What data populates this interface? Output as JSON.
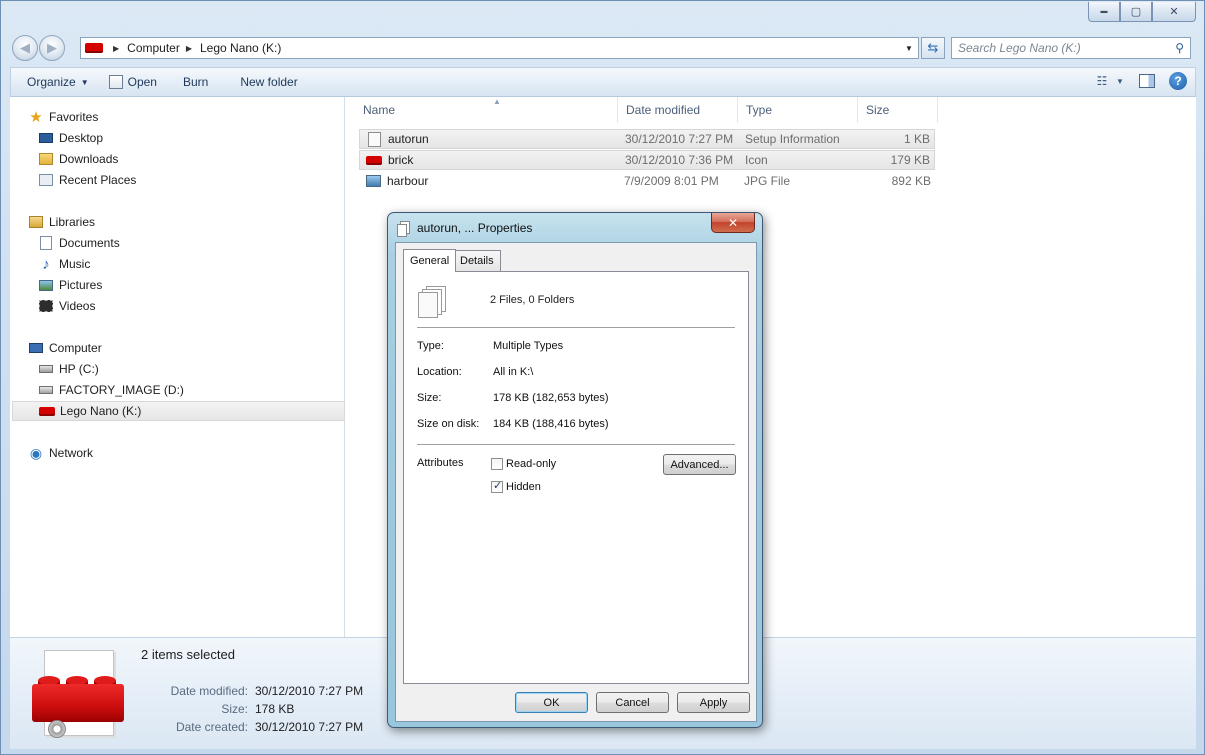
{
  "window": {
    "controls": {
      "minimize": "▬",
      "maximize": "▢",
      "close": "✕"
    }
  },
  "address": {
    "crumbs": [
      "Computer",
      "Lego Nano (K:)"
    ],
    "search_placeholder": "Search Lego Nano (K:)"
  },
  "toolbar": {
    "organize_label": "Organize",
    "open_label": "Open",
    "burn_label": "Burn",
    "new_folder_label": "New folder"
  },
  "sidebar": {
    "favorites": {
      "label": "Favorites",
      "items": [
        "Desktop",
        "Downloads",
        "Recent Places"
      ]
    },
    "libraries": {
      "label": "Libraries",
      "items": [
        "Documents",
        "Music",
        "Pictures",
        "Videos"
      ]
    },
    "computer": {
      "label": "Computer",
      "items": [
        "HP (C:)",
        "FACTORY_IMAGE (D:)",
        "Lego Nano (K:)"
      ]
    },
    "network": {
      "label": "Network"
    }
  },
  "file_list": {
    "columns": [
      "Name",
      "Date modified",
      "Type",
      "Size"
    ],
    "rows": [
      {
        "name": "autorun",
        "date": "30/12/2010 7:27 PM",
        "type": "Setup Information",
        "size": "1 KB",
        "selected": true
      },
      {
        "name": "brick",
        "date": "30/12/2010 7:36 PM",
        "type": "Icon",
        "size": "179 KB",
        "selected": true
      },
      {
        "name": "harbour",
        "date": "7/9/2009 8:01 PM",
        "type": "JPG File",
        "size": "892 KB",
        "selected": false
      }
    ]
  },
  "details": {
    "summary": "2 items selected",
    "date_modified_label": "Date modified:",
    "date_modified": "30/12/2010 7:27 PM",
    "size_label": "Size:",
    "size": "178 KB",
    "date_created_label": "Date created:",
    "date_created": "30/12/2010 7:27 PM"
  },
  "dialog": {
    "title": "autorun, ... Properties",
    "close": "✕",
    "tabs": [
      "General",
      "Details"
    ],
    "summary": "2 Files, 0 Folders",
    "type_label": "Type:",
    "type_value": "Multiple Types",
    "location_label": "Location:",
    "location_value": "All in K:\\",
    "size_label": "Size:",
    "size_value": "178 KB (182,653 bytes)",
    "size_on_disk_label": "Size on disk:",
    "size_on_disk_value": "184 KB (188,416 bytes)",
    "attributes_label": "Attributes",
    "readonly_label": "Read-only",
    "readonly_checked": false,
    "hidden_label": "Hidden",
    "hidden_checked": true,
    "advanced_label": "Advanced...",
    "ok_label": "OK",
    "cancel_label": "Cancel",
    "apply_label": "Apply"
  },
  "colors": {
    "accent": "#1e395b",
    "selection": "#e6e6e6",
    "lego_red": "#d40000",
    "dialog_frame": "#9fcadf"
  }
}
